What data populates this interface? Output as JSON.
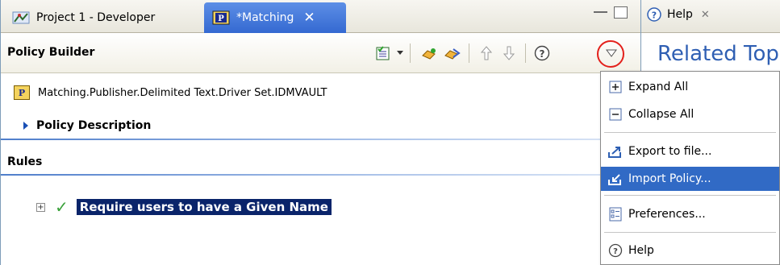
{
  "editor": {
    "tabs": [
      {
        "label": "Project 1 - Developer",
        "active": false
      },
      {
        "label": "*Matching",
        "active": true
      }
    ],
    "toolbar": {
      "title": "Policy Builder",
      "buttons": [
        "new-rule-icon",
        "dropdown-arrow-icon",
        "enable-rule-icon",
        "disable-rule-icon",
        "move-up-icon",
        "move-down-icon",
        "help-icon",
        "view-menu-icon"
      ]
    },
    "policy_path": "Matching.Publisher.Delimited Text.Driver Set.IDMVAULT",
    "policy_description": "Policy Description",
    "rules_label": "Rules",
    "rules": [
      {
        "name": "Require users to have a Given Name",
        "enabled": true,
        "selected": true
      }
    ]
  },
  "help": {
    "tab_label": "Help",
    "related_topics": "Related Top"
  },
  "menu": {
    "items": [
      {
        "label": "Expand All",
        "icon": "expand-all-icon"
      },
      {
        "label": "Collapse All",
        "icon": "collapse-all-icon"
      },
      {
        "label": "Export to file...",
        "icon": "export-icon"
      },
      {
        "label": "Import Policy...",
        "icon": "import-icon",
        "selected": true
      },
      {
        "label": "Preferences...",
        "icon": "preferences-icon"
      },
      {
        "label": "Help",
        "icon": "help-icon"
      }
    ]
  },
  "colors": {
    "active_tab": "#3469d1",
    "selection": "#0a246a",
    "menu_highlight": "#316ac5",
    "callout": "#e3201b",
    "link_blue": "#2f5fb3"
  }
}
